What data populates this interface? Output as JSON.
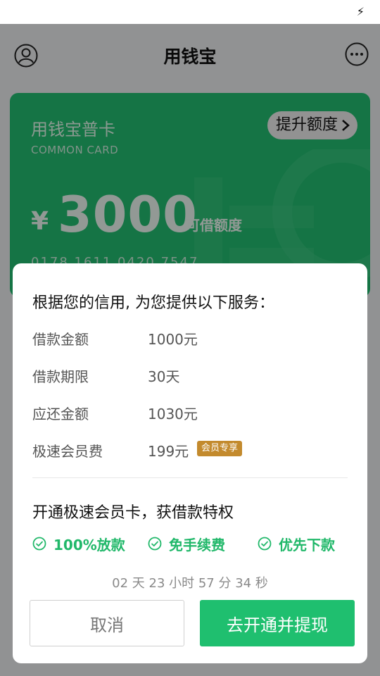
{
  "statusbar": {
    "icon": "lightning-icon"
  },
  "header": {
    "title": "用钱宝",
    "left_icon": "user-icon",
    "right_icon": "more-icon"
  },
  "card": {
    "name": "用钱宝普卡",
    "subtitle": "COMMON CARD",
    "upgrade_label": "提升额度",
    "currency": "¥",
    "amount": "3000",
    "amount_label": "可借额度",
    "card_number": "0178 1611 0420 7547",
    "color": "#24c173"
  },
  "modal": {
    "heading": "根据您的信用, 为您提供以下服务：",
    "rows": [
      {
        "label": "借款金额",
        "value": "1000元"
      },
      {
        "label": "借款期限",
        "value": "30天"
      },
      {
        "label": "应还金额",
        "value": "1030元"
      },
      {
        "label": "极速会员费",
        "value": "199元",
        "badge": "会员专享"
      }
    ],
    "promo_title": "开通极速会员卡，获借款特权",
    "perks": [
      "100%放款",
      "免手续费",
      "优先下款"
    ],
    "countdown": "02 天 23 小时 57 分 34 秒",
    "cancel_label": "取消",
    "confirm_label": "去开通并提现",
    "accent": "#1fbf6f",
    "badge_color": "#c38a2d"
  }
}
